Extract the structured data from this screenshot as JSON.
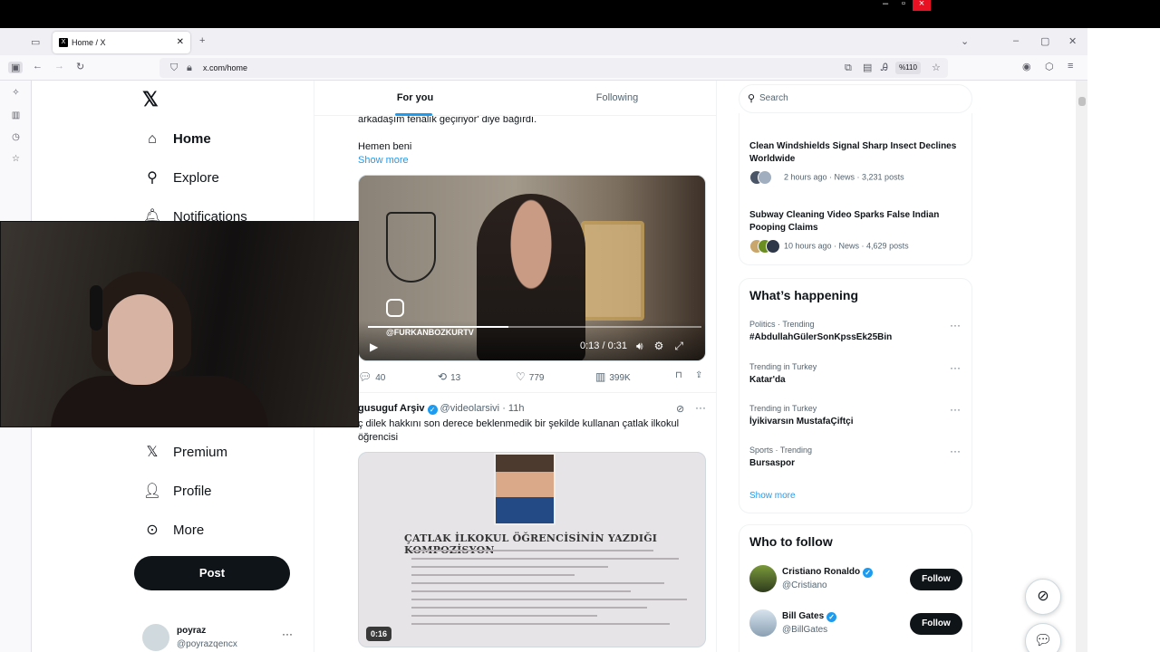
{
  "browser": {
    "tab_title": "Home / X",
    "tab_favicon": "X",
    "url": "x.com/home",
    "zoom": "%110"
  },
  "nav": {
    "items": [
      {
        "label": "Home",
        "icon": "home-icon"
      },
      {
        "label": "Explore",
        "icon": "search-icon"
      },
      {
        "label": "Notifications",
        "icon": "bell-icon"
      },
      {
        "label": "Premium",
        "icon": "x-logo-icon"
      },
      {
        "label": "Profile",
        "icon": "person-icon"
      },
      {
        "label": "More",
        "icon": "more-circle-icon"
      }
    ],
    "post_label": "Post",
    "account": {
      "name": "poyraz",
      "handle": "@poyrazqencx"
    }
  },
  "feed": {
    "tabs": [
      {
        "label": "For you"
      },
      {
        "label": "Following"
      }
    ],
    "tweet1": {
      "text_line": "arkadaşım fenalık geçiriyor' diye bağırdı.",
      "text_line2": "Hemen beni",
      "show_more": "Show more",
      "video": {
        "handle": "@FURKANBOZKURTV",
        "time": "0:13 / 0:31",
        "progress": 0.42
      },
      "stats": {
        "replies": "40",
        "reposts": "13",
        "likes": "779",
        "views": "399K"
      }
    },
    "tweet2": {
      "name": "gusuguf Arşiv",
      "handle": "@videolarsivi",
      "time": "· 11h",
      "text": "ç dilek hakkını son derece beklenmedik bir şekilde kullanan çatlak ilkokul öğrencisi",
      "media_title": "ÇATLAK İLKOKUL ÖĞRENCİSİNİN YAZDIĞI KOMPOZİSYON",
      "duration": "0:16"
    }
  },
  "right": {
    "search_placeholder": "Search",
    "news": [
      {
        "title": "Clean Windshields Signal Sharp Insect Declines Worldwide",
        "meta": "2 hours ago · News · 3,231 posts"
      },
      {
        "title": "Subway Cleaning Video Sparks False Indian Pooping Claims",
        "meta": "10 hours ago · News · 4,629 posts"
      }
    ],
    "happening": {
      "title": "What’s happening",
      "trends": [
        {
          "category": "Politics · Trending",
          "name": "#AbdullahGülerSonKpssEk25Bin"
        },
        {
          "category": "Trending in Turkey",
          "name": "Katar'da"
        },
        {
          "category": "Trending in Turkey",
          "name": "İyikivarsın MustafaÇiftçi"
        },
        {
          "category": "Sports · Trending",
          "name": "Bursaspor"
        }
      ],
      "show_more": "Show more"
    },
    "who_to_follow": {
      "title": "Who to follow",
      "accounts": [
        {
          "name": "Cristiano Ronaldo",
          "handle": "@Cristiano",
          "button": "Follow"
        },
        {
          "name": "Bill Gates",
          "handle": "@BillGates",
          "button": "Follow"
        }
      ]
    }
  },
  "colors": {
    "accent": "#1d9bf0",
    "text": "#0f1419",
    "muted": "#536471",
    "close": "#e81123"
  }
}
